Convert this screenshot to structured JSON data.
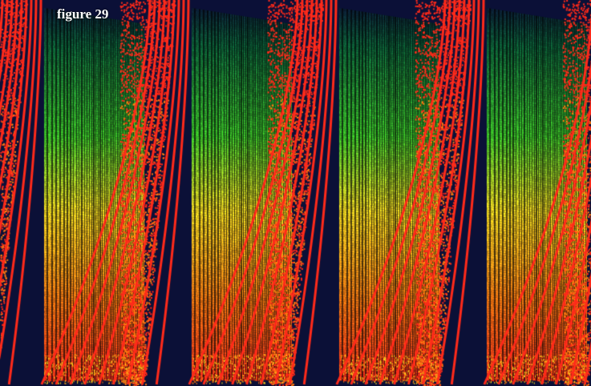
{
  "figure": {
    "caption": "figure 29"
  },
  "artwork": {
    "background_color": "#0b1037",
    "palette": {
      "red": "#ff2a1a",
      "orange": "#ff7a10",
      "yellow": "#ffe020",
      "green": "#3fcf2a",
      "dark_green": "#0e6a3a",
      "navy": "#0b1037"
    },
    "panel_count": 4
  }
}
